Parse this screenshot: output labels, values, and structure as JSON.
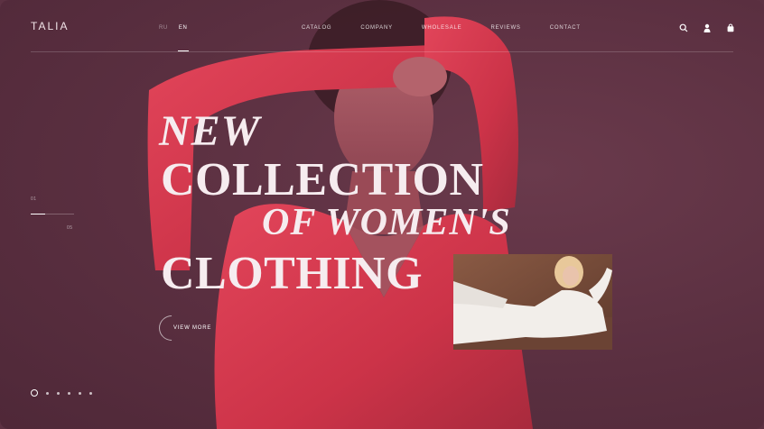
{
  "brand": {
    "logo": "TALIA"
  },
  "languages": [
    {
      "code": "RU",
      "active": false
    },
    {
      "code": "EN",
      "active": true
    }
  ],
  "nav": [
    "CATALOG",
    "COMPANY",
    "WHOLESALE",
    "REVIEWS",
    "CONTACT"
  ],
  "icons": [
    "search-icon",
    "user-icon",
    "bag-icon"
  ],
  "slider": {
    "current": "01",
    "total": "05",
    "progress": 0.33
  },
  "headline": {
    "line1": "NEW",
    "line2": "COLLECTION",
    "line3": "OF WOMEN'S",
    "line4": "CLOTHING"
  },
  "cta": {
    "label": "VIEW MORE"
  },
  "pagination": {
    "count": 6,
    "active_index": 0
  },
  "colors": {
    "background": "#5c3142",
    "dress": "#d63a4e",
    "text": "#f6ecef"
  }
}
